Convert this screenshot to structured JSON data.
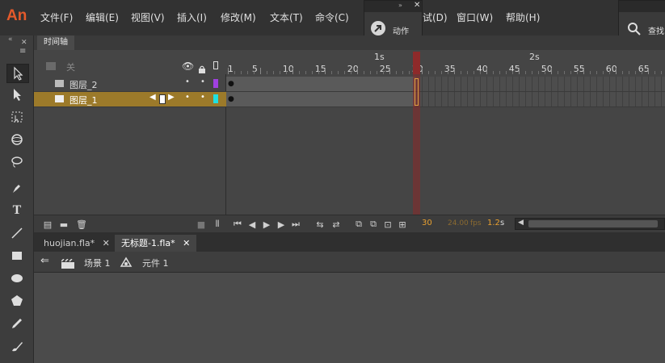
{
  "app": {
    "logo": "An"
  },
  "menu": [
    "文件(F)",
    "编辑(E)",
    "视图(V)",
    "插入(I)",
    "修改(M)",
    "文本(T)",
    "命令(C)",
    "试(D)",
    "窗口(W)",
    "帮助(H)"
  ],
  "panels": {
    "actions_label": "动作",
    "search_label": "查找"
  },
  "timeline": {
    "tab_label": "时间轴",
    "header_label": "关",
    "seconds": [
      "1s",
      "2s"
    ],
    "frame_numbers": [
      "1",
      "5",
      "10",
      "15",
      "20",
      "25",
      "30",
      "35",
      "40",
      "45",
      "50",
      "55",
      "60",
      "65"
    ],
    "layers": [
      {
        "name": "图层_2",
        "color": "#a040e0",
        "selected": false
      },
      {
        "name": "图层_1",
        "color": "#20e0e0",
        "selected": true
      }
    ],
    "current_frame": "30",
    "fps": "24.00",
    "fps_unit": "fps",
    "elapsed": "1.2",
    "elapsed_unit": "s"
  },
  "documents": {
    "tabs": [
      {
        "label": "huojian.fla*",
        "active": false
      },
      {
        "label": "无标题-1.fla*",
        "active": true
      }
    ]
  },
  "editbar": {
    "scene": "场景 1",
    "symbol": "元件 1"
  },
  "colors": {
    "accent": "#e55a2b",
    "selection": "#9c7a2a",
    "playhead": "#c03030"
  }
}
